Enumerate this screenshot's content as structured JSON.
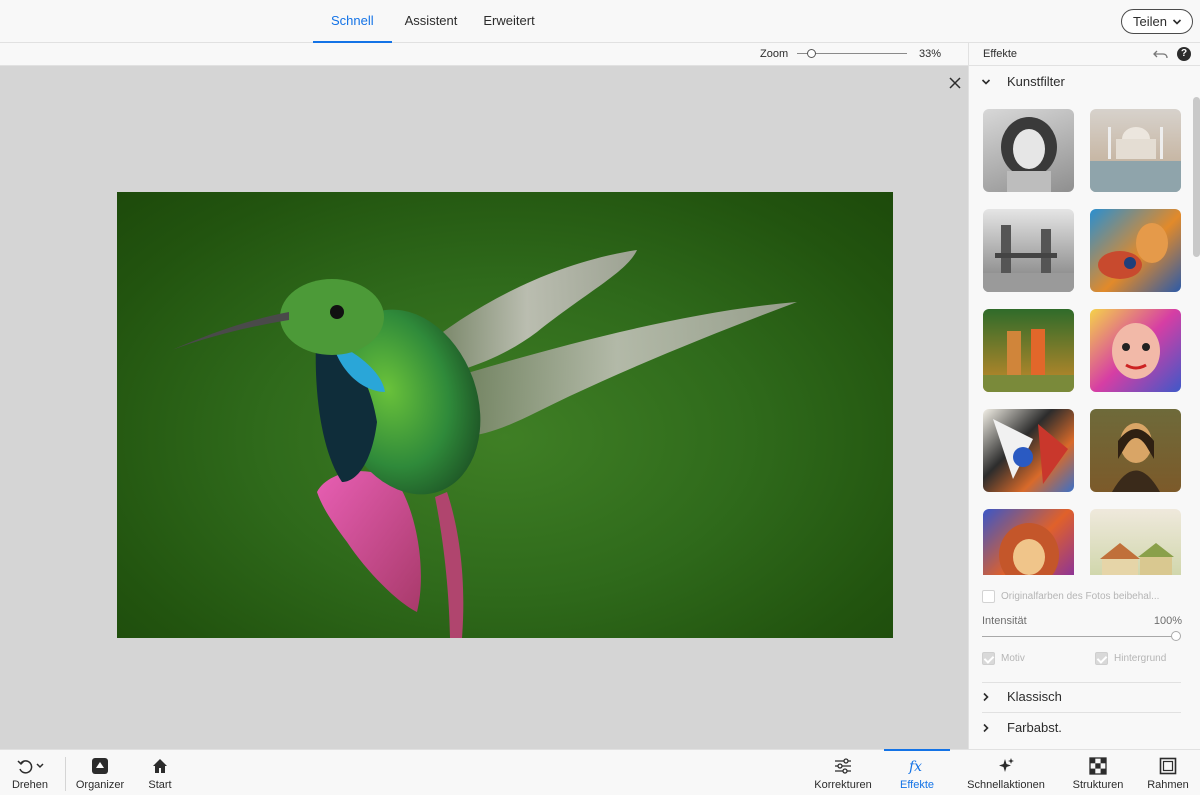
{
  "topbar": {
    "tabs": [
      {
        "label": "Schnell",
        "active": true
      },
      {
        "label": "Assistent",
        "active": false
      },
      {
        "label": "Erweitert",
        "active": false
      }
    ],
    "share_label": "Teilen"
  },
  "options": {
    "zoom_label": "Zoom",
    "zoom_value": "33%",
    "zoom_level": 0.33
  },
  "panel": {
    "title": "Effekte",
    "active_section": "Kunstfilter",
    "thumbnails": [
      {
        "name": "portrait-sketch"
      },
      {
        "name": "taj-mahal"
      },
      {
        "name": "tower-bridge-bw"
      },
      {
        "name": "colorful-woman"
      },
      {
        "name": "tahitian-women"
      },
      {
        "name": "cubist-face"
      },
      {
        "name": "abstract-collage"
      },
      {
        "name": "mona-lisa"
      },
      {
        "name": "lion-colorful"
      },
      {
        "name": "village-sketch"
      }
    ],
    "keep_colors_label": "Originalfarben des Fotos beibehal...",
    "intensity_label": "Intensität",
    "intensity_value": "100%",
    "motif_label": "Motiv",
    "background_label": "Hintergrund",
    "sections": [
      {
        "label": "Klassisch"
      },
      {
        "label": "Farbabst."
      }
    ]
  },
  "bottombar": {
    "left": [
      {
        "label": "Drehen"
      },
      {
        "label": "Organizer"
      },
      {
        "label": "Start"
      }
    ],
    "right": [
      {
        "label": "Korrekturen"
      },
      {
        "label": "Effekte",
        "active": true
      },
      {
        "label": "Schnellaktionen"
      },
      {
        "label": "Strukturen"
      },
      {
        "label": "Rahmen"
      }
    ]
  },
  "colors": {
    "accent": "#1473e6",
    "canvas_bg": "#d5d5d5",
    "panel_bg": "#f8f8f8"
  }
}
